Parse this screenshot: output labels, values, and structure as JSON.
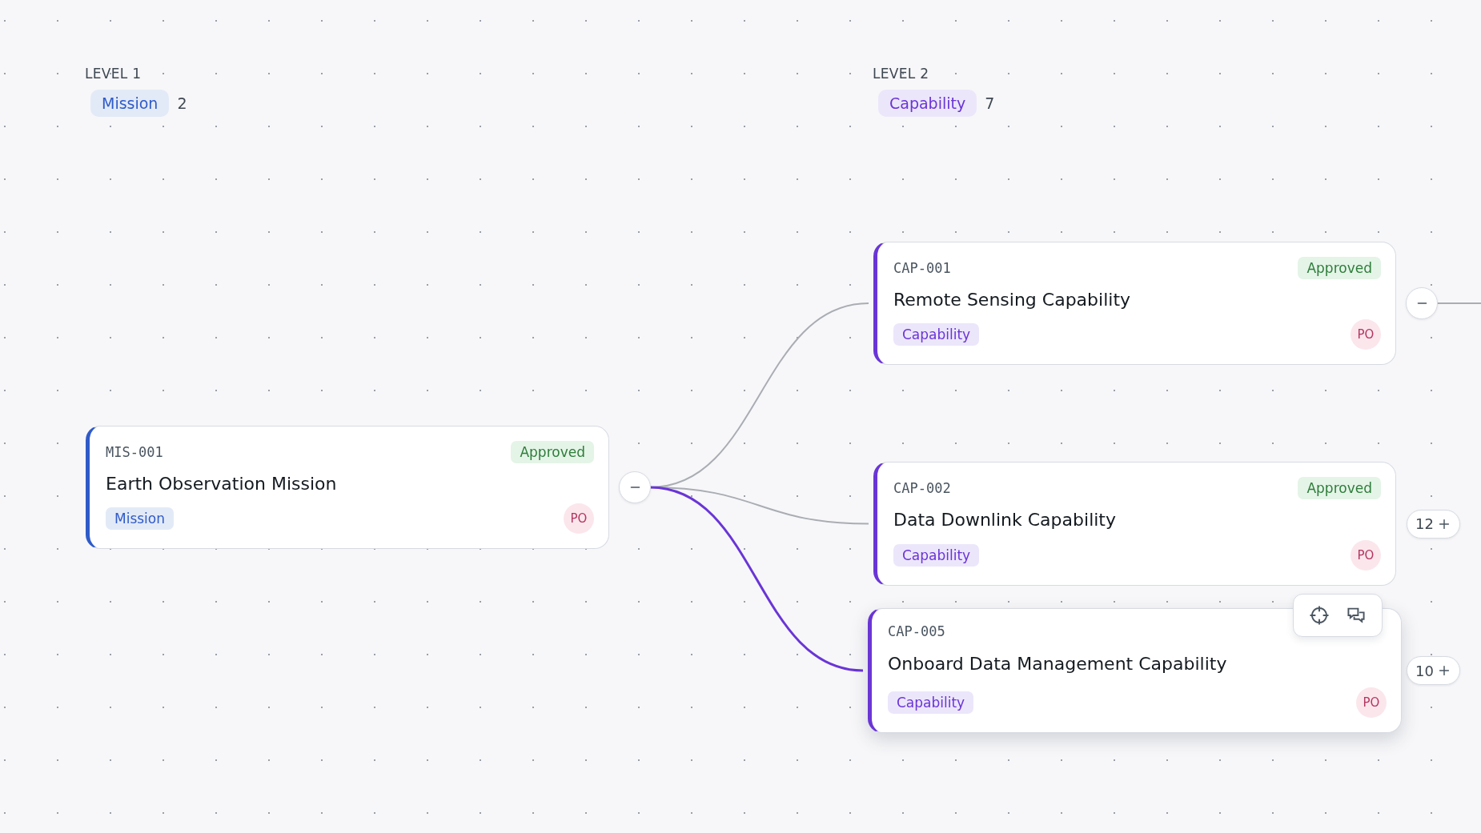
{
  "levels": [
    {
      "label": "LEVEL 1",
      "kind": "mission",
      "type": "Mission",
      "count": "2"
    },
    {
      "label": "LEVEL 2",
      "kind": "capability",
      "type": "Capability",
      "count": "7"
    }
  ],
  "nodes": [
    {
      "id": "MIS-001",
      "status": "Approved",
      "title": "Earth Observation Mission",
      "type": "Mission",
      "kind": "mission",
      "owner": "PO",
      "selected": false,
      "toggle": {
        "kind": "collapse"
      }
    },
    {
      "id": "CAP-001",
      "status": "Approved",
      "title": "Remote Sensing Capability",
      "type": "Capability",
      "kind": "capability",
      "owner": "PO",
      "selected": false,
      "toggle": {
        "kind": "collapse"
      }
    },
    {
      "id": "CAP-002",
      "status": "Approved",
      "title": "Data Downlink Capability",
      "type": "Capability",
      "kind": "capability",
      "owner": "PO",
      "selected": false,
      "toggle": {
        "kind": "expand",
        "count": "12"
      }
    },
    {
      "id": "CAP-005",
      "title": "Onboard Data Management Capability",
      "type": "Capability",
      "kind": "capability",
      "owner": "PO",
      "selected": true,
      "toggle": {
        "kind": "expand",
        "count": "10"
      }
    }
  ]
}
